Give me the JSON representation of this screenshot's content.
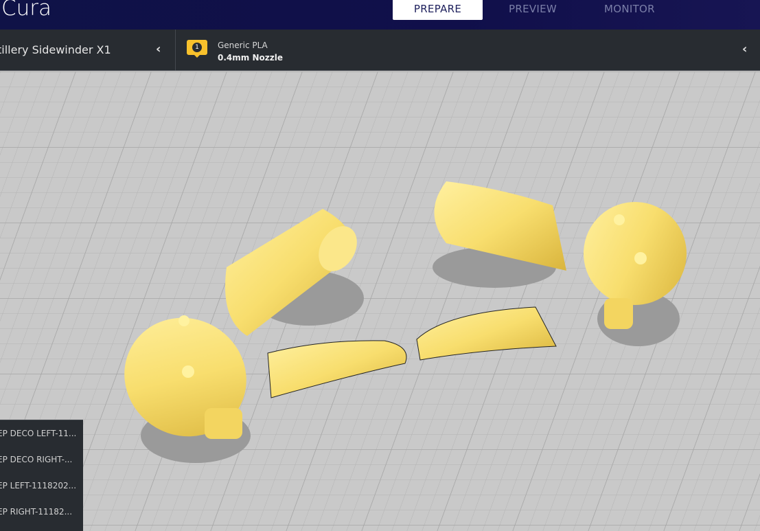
{
  "header": {
    "app_name": "Cura",
    "tabs": [
      {
        "label": "PREPARE",
        "active": true
      },
      {
        "label": "PREVIEW"
      },
      {
        "label": "MONITOR"
      }
    ]
  },
  "printer": {
    "name": "tillery Sidewinder X1"
  },
  "material": {
    "extruder_number": "1",
    "material": "Generic PLA",
    "nozzle": "0.4mm Nozzle",
    "color": "#f8c12c"
  },
  "objects": [
    "EP DECO LEFT-11...",
    "EP DECO RIGHT-...",
    "EP LEFT-1118202...",
    "EP RIGHT-11182..."
  ],
  "model_color": "#f8e07a"
}
